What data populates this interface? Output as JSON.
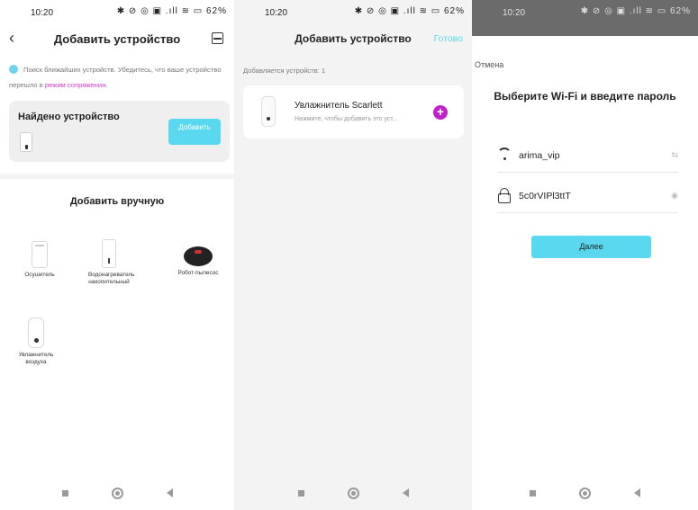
{
  "status_bar": {
    "time": "10:20",
    "icons": "✱ ⊘ ◎ ▣ .ıll ≋ ▭ 62%"
  },
  "screen1": {
    "title": "Добавить устройство",
    "hint_text": "Поиск ближайших устройств. Убедитесь, что ваше устройство перешло в ",
    "hint_link": "режим сопряжения",
    "hint_end": ".",
    "found_title": "Найдено устройство",
    "add_button": "Добавить",
    "manual_title": "Добавить вручную",
    "devices": [
      {
        "label": "Осушитель"
      },
      {
        "label": "Водонагреватель накопительный"
      },
      {
        "label": "Робот-пылесос"
      },
      {
        "label": "Увлажнитель воздуха"
      }
    ]
  },
  "screen2": {
    "title": "Добавить устройство",
    "done": "Готово",
    "count_text": "Добавляется устройств: 1",
    "device_name": "Увлажнитель Scarlett",
    "device_sub": "Нажмите, чтобы добавить это уст..."
  },
  "screen3": {
    "cancel": "Отмена",
    "title": "Выберите Wi-Fi и введите пароль",
    "ssid": "arima_vip",
    "password": "5c0rVIPl3ttT",
    "next_button": "Далее"
  },
  "icons": {
    "back": "chevron-left-icon",
    "scan": "scan-icon",
    "wifi": "wifi-icon",
    "lock": "lock-icon",
    "eye": "eye-icon",
    "swap": "swap-icon",
    "plus": "plus-icon"
  },
  "colors": {
    "accent": "#5ad8f0",
    "link": "#d43bd4",
    "add": "#c020c8"
  }
}
